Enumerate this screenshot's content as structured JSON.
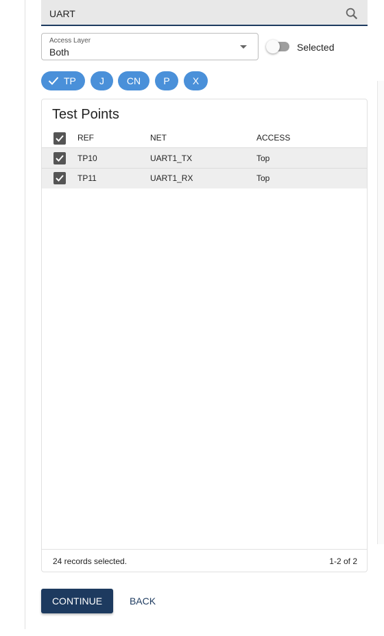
{
  "search": {
    "value": "UART"
  },
  "access_layer": {
    "label": "Access Layer",
    "value": "Both"
  },
  "selected_toggle": {
    "label": "Selected",
    "on": false
  },
  "chips": [
    {
      "label": "TP",
      "selected": true
    },
    {
      "label": "J",
      "selected": false
    },
    {
      "label": "CN",
      "selected": false
    },
    {
      "label": "P",
      "selected": false
    },
    {
      "label": "X",
      "selected": false
    }
  ],
  "table": {
    "title": "Test Points",
    "columns": {
      "ref": "REF",
      "net": "NET",
      "access": "ACCESS"
    },
    "rows": [
      {
        "ref": "TP10",
        "net": "UART1_TX",
        "access": "Top",
        "checked": true
      },
      {
        "ref": "TP11",
        "net": "UART1_RX",
        "access": "Top",
        "checked": true
      }
    ],
    "footer": {
      "selected_text": "24 records selected.",
      "pagination": "1-2 of 2"
    }
  },
  "actions": {
    "continue": "CONTINUE",
    "back": "BACK"
  },
  "colors": {
    "primary": "#1d3a5f",
    "chip": "#4a90d9"
  }
}
